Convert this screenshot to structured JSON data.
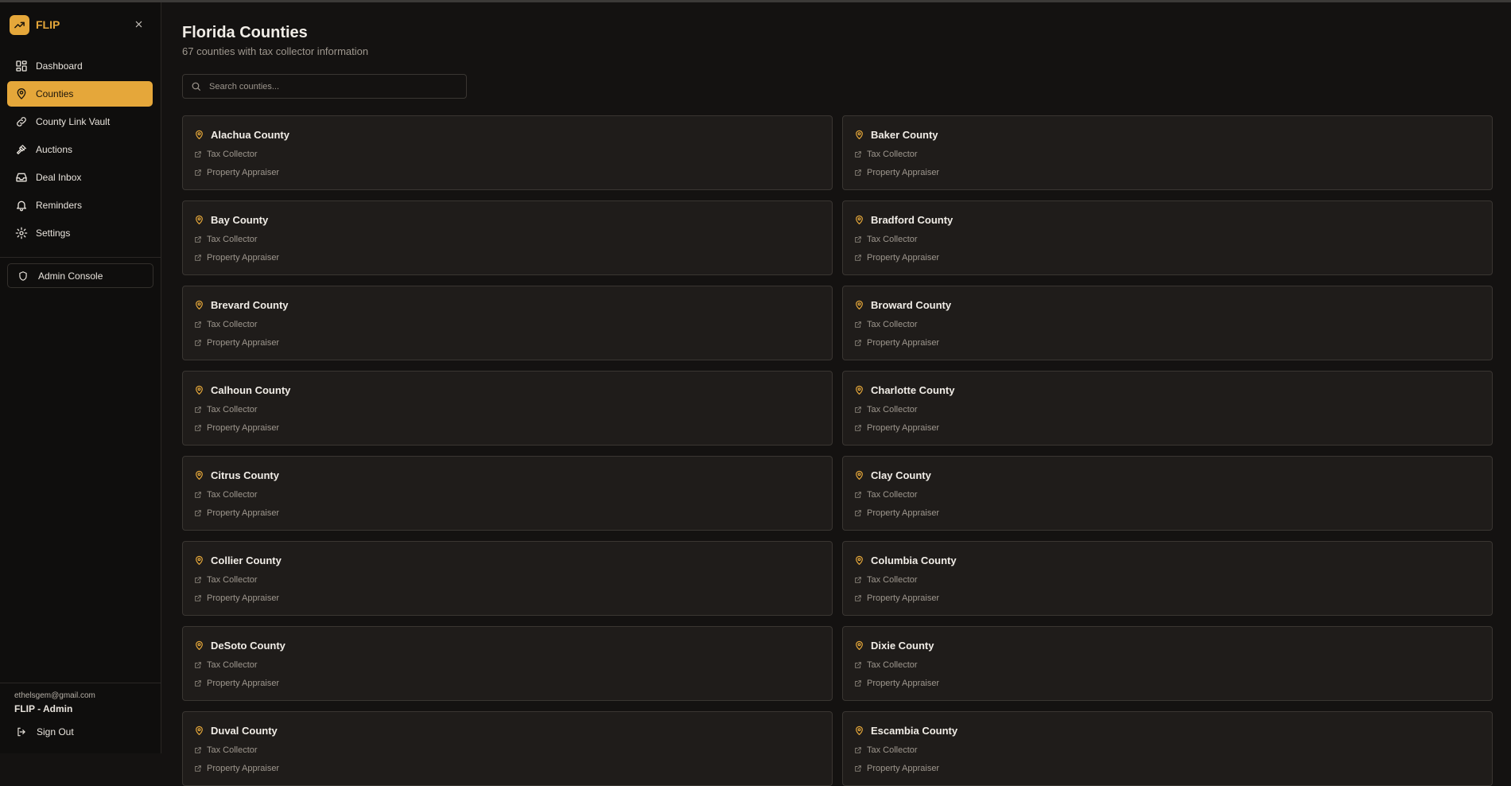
{
  "brand": {
    "name": "FLIP"
  },
  "sidebar": {
    "items": [
      {
        "label": "Dashboard",
        "icon": "dashboard-icon",
        "active": false
      },
      {
        "label": "Counties",
        "icon": "map-pin-icon",
        "active": true
      },
      {
        "label": "County Link Vault",
        "icon": "link-icon",
        "active": false
      },
      {
        "label": "Auctions",
        "icon": "gavel-icon",
        "active": false
      },
      {
        "label": "Deal Inbox",
        "icon": "inbox-icon",
        "active": false
      },
      {
        "label": "Reminders",
        "icon": "bell-icon",
        "active": false
      },
      {
        "label": "Settings",
        "icon": "gear-icon",
        "active": false
      }
    ],
    "admin_label": "Admin Console",
    "user_email": "ethelsgem@gmail.com",
    "user_role": "FLIP - Admin",
    "signout_label": "Sign Out"
  },
  "main": {
    "title": "Florida Counties",
    "subtitle": "67 counties with tax collector information",
    "search_placeholder": "Search counties...",
    "link_labels": {
      "tax_collector": "Tax Collector",
      "property_appraiser": "Property Appraiser"
    },
    "counties": [
      "Alachua County",
      "Baker County",
      "Bay County",
      "Bradford County",
      "Brevard County",
      "Broward County",
      "Calhoun County",
      "Charlotte County",
      "Citrus County",
      "Clay County",
      "Collier County",
      "Columbia County",
      "DeSoto County",
      "Dixie County",
      "Duval County",
      "Escambia County"
    ]
  },
  "colors": {
    "accent": "#e5a73a",
    "background": "#141211",
    "card": "#1f1c1a"
  }
}
